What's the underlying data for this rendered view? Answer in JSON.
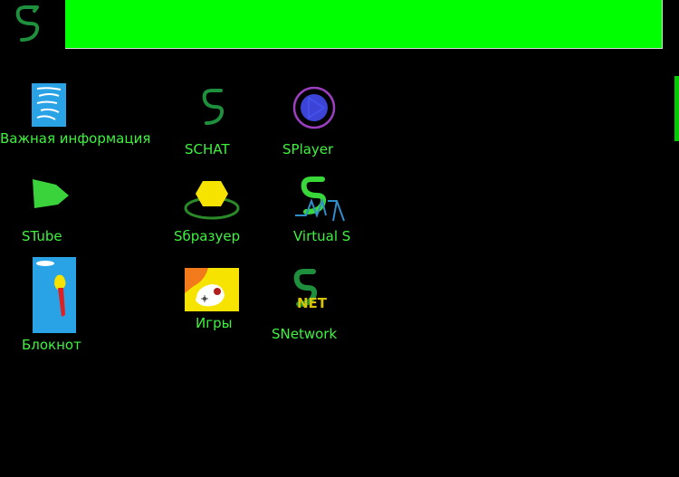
{
  "colors": {
    "background": "#000000",
    "top_bar": "#00ff00",
    "label": "#3ef23e"
  },
  "start_icon": "s-logo-icon",
  "desktop": {
    "icons": [
      {
        "id": "important-info",
        "label": "Важная информация",
        "icon": "document-icon"
      },
      {
        "id": "schat",
        "label": "SCHAT",
        "icon": "s-logo-icon"
      },
      {
        "id": "splayer",
        "label": "SPlayer",
        "icon": "play-icon"
      },
      {
        "id": "stube",
        "label": "STube",
        "icon": "green-play-icon"
      },
      {
        "id": "sbrowser",
        "label": "Sбразуер",
        "icon": "yellow-disc-icon"
      },
      {
        "id": "virtual-s",
        "label": "Virtual S",
        "icon": "virtual-s-icon"
      },
      {
        "id": "notepad",
        "label": "Блокнот",
        "icon": "notepad-icon"
      },
      {
        "id": "games",
        "label": "Игры",
        "icon": "games-icon"
      },
      {
        "id": "snetwork",
        "label": "SNetwork",
        "icon": "s-net-icon"
      }
    ]
  }
}
